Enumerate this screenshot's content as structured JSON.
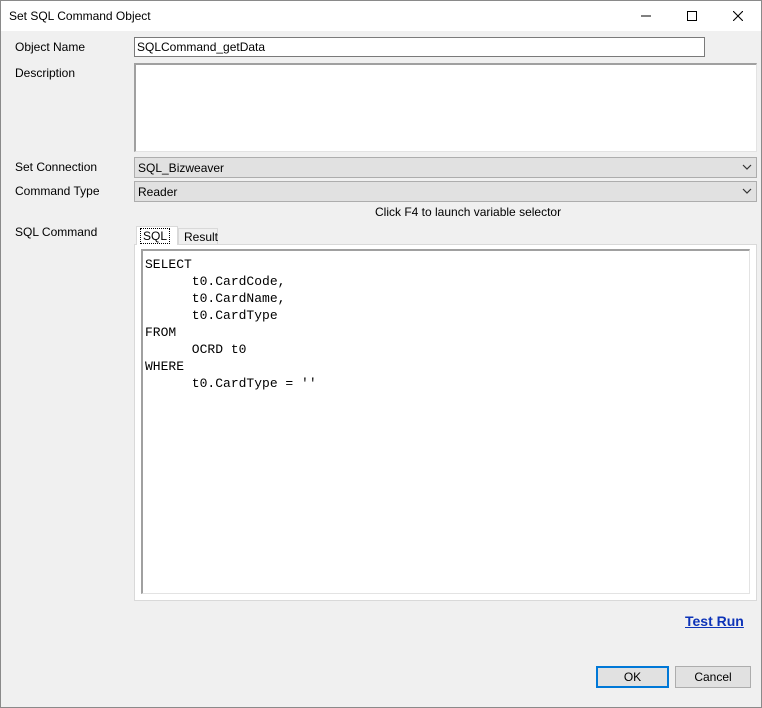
{
  "window": {
    "title": "Set SQL Command Object"
  },
  "form": {
    "object_name_label": "Object Name",
    "object_name_value": "SQLCommand_getData",
    "description_label": "Description",
    "description_value": "",
    "connection_label": "Set Connection",
    "connection_value": "SQL_Bizweaver",
    "command_type_label": "Command Type",
    "command_type_value": "Reader",
    "hint": "Click F4 to launch variable selector",
    "sql_command_label": "SQL Command"
  },
  "tabs": [
    {
      "label": "SQL",
      "selected": true
    },
    {
      "label": "Result",
      "selected": false
    }
  ],
  "sql_text": "SELECT\n      t0.CardCode,\n      t0.CardName,\n      t0.CardType\nFROM\n      OCRD t0\nWHERE\n      t0.CardType = ''",
  "actions": {
    "test_run": "Test Run",
    "ok": "OK",
    "cancel": "Cancel"
  },
  "icons": {
    "minimize": "minimize-icon",
    "maximize": "maximize-icon",
    "close": "close-icon",
    "dropdown": "chevron-down-icon"
  },
  "colors": {
    "accent": "#0078d7",
    "link": "#0d33b8"
  }
}
